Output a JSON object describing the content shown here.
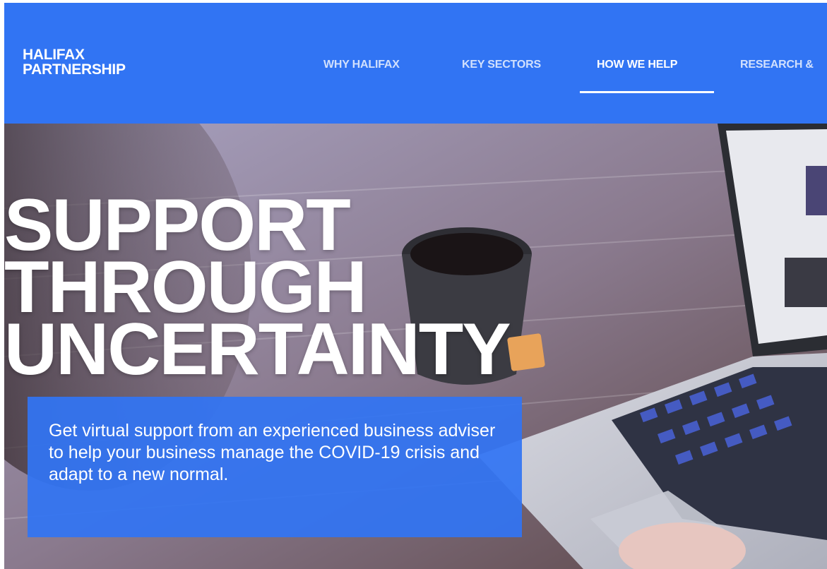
{
  "brand": {
    "line1": "HALIFAX",
    "line2": "PARTNERSHIP"
  },
  "nav": {
    "items": [
      {
        "label": "WHY HALIFAX"
      },
      {
        "label": "KEY SECTORS"
      },
      {
        "label": "HOW WE HELP"
      },
      {
        "label": "RESEARCH &"
      }
    ]
  },
  "hero": {
    "title_lines": [
      "SUPPORT",
      "THROUGH",
      "UNCERTAINTY"
    ],
    "description": "Get virtual support from an experienced business adviser to help your business manage the COVID-19 crisis and adapt to a new normal."
  },
  "colors": {
    "brand_blue": "#3174f3",
    "text_white": "#ffffff"
  }
}
